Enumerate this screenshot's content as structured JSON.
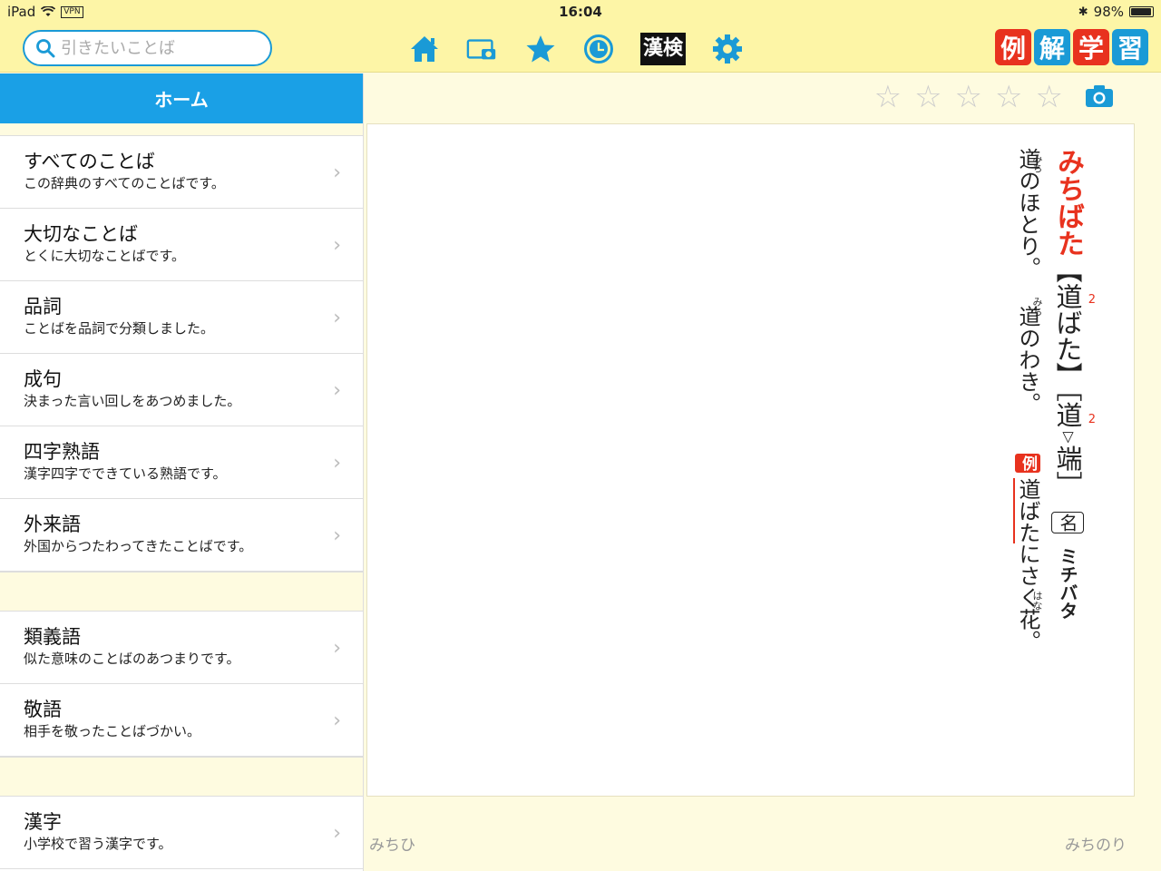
{
  "status": {
    "device": "iPad",
    "vpn": "VPN",
    "time": "16:04",
    "battery": "98%"
  },
  "toolbar": {
    "search_placeholder": "引きたいことば",
    "kanken_label": "漢検",
    "logo": [
      "例",
      "解",
      "学",
      "習"
    ],
    "logo_colors": [
      "#e8321e",
      "#1a9ad6",
      "#e8321e",
      "#1a9ad6"
    ]
  },
  "sidebar": {
    "header": "ホーム",
    "groups": [
      [
        {
          "title": "すべてのことば",
          "desc": "この辞典のすべてのことばです。"
        },
        {
          "title": "大切なことば",
          "desc": "とくに大切なことばです。"
        },
        {
          "title": "品詞",
          "desc": "ことばを品詞で分類しました。"
        },
        {
          "title": "成句",
          "desc": "決まった言い回しをあつめました。"
        },
        {
          "title": "四字熟語",
          "desc": "漢字四字でできている熟語です。"
        },
        {
          "title": "外来語",
          "desc": "外国からつたわってきたことばです。"
        }
      ],
      [
        {
          "title": "類義語",
          "desc": "似た意味のことばのあつまりです。"
        },
        {
          "title": "敬語",
          "desc": "相手を敬ったことばづかい。"
        }
      ],
      [
        {
          "title": "漢字",
          "desc": "小学校で習う漢字です。"
        }
      ]
    ]
  },
  "entry": {
    "headword": "みちばた",
    "kanji1": "道ばた",
    "kanji2_a": "道",
    "kanji2_mark": "▽",
    "kanji2_b": "端",
    "grade_sup": "2",
    "pos": "名",
    "katakana": "ミチバタ",
    "def1_ruby": "みち",
    "def1": "道のほとり。",
    "def2_ruby": "みち",
    "def2": "道のわき。",
    "example_label": "例",
    "example_head": "道ばた",
    "example_mid": "にさく",
    "example_kanji": "花",
    "example_ruby": "はな",
    "example_tail": "。"
  },
  "nav": {
    "prev": "みちひ",
    "next": "みちのり"
  },
  "rating": {
    "stars": 5,
    "filled": 0
  }
}
